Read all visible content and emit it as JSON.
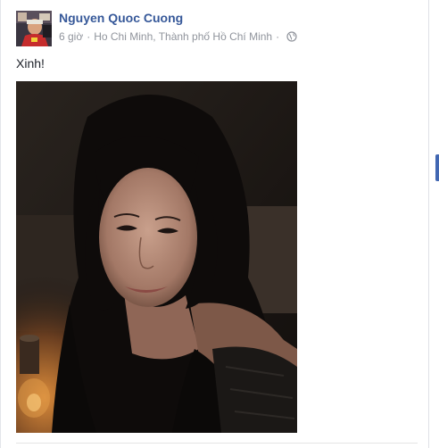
{
  "post": {
    "author": "Nguyen Quoc Cuong",
    "time": "6 giờ",
    "location": "Ho Chi Minh, Thành phố Hồ Chí Minh",
    "separator": "·",
    "privacy_icon": "globe-icon",
    "text": "Xinh!"
  },
  "colors": {
    "link": "#365899",
    "meta": "#90949c",
    "text": "#1d2129",
    "accent": "#4267b2"
  }
}
